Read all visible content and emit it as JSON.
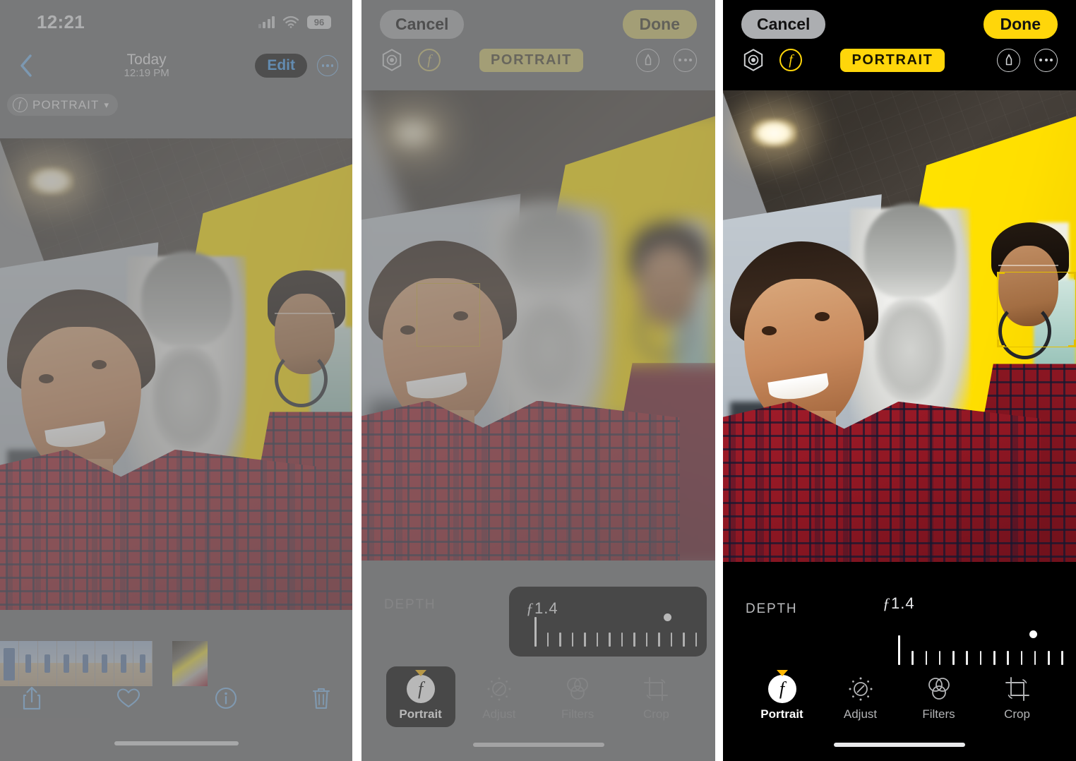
{
  "panels": [
    {
      "id": "viewer",
      "statusbar": {
        "time": "12:21",
        "battery": "96",
        "wifi_icon": "wifi-icon",
        "signal_icon": "cellular-signal-icon"
      },
      "navbar": {
        "back_icon": "chevron-left-icon",
        "title": "Today",
        "subtitle": "12:19 PM",
        "edit_label": "Edit",
        "more_icon": "ellipsis-circle-icon"
      },
      "badge": {
        "icon": "aperture-f-icon",
        "label": "PORTRAIT",
        "chevron": "chevron-down-icon"
      },
      "toolbar": [
        {
          "name": "share-button",
          "icon": "share-icon"
        },
        {
          "name": "favorite-button",
          "icon": "heart-icon"
        },
        {
          "name": "info-button",
          "icon": "info-circle-icon"
        },
        {
          "name": "delete-button",
          "icon": "trash-icon"
        }
      ],
      "filmstrip_frames": 8
    },
    {
      "id": "editor-dimmed",
      "header": {
        "cancel_label": "Cancel",
        "done_label": "Done",
        "live_icon": "live-photo-icon",
        "depth_icon": "aperture-f-icon",
        "portrait_chip": "PORTRAIT",
        "markup_icon": "markup-pen-icon",
        "more_icon": "ellipsis-circle-icon"
      },
      "depth": {
        "label": "DEPTH",
        "f_symbol": "ƒ",
        "value": "1.4",
        "ticks_total": 14
      },
      "tabs": [
        {
          "label": "Portrait",
          "icon": "portrait-f-icon",
          "active": true
        },
        {
          "label": "Adjust",
          "icon": "adjust-dial-icon",
          "active": false
        },
        {
          "label": "Filters",
          "icon": "filters-circles-icon",
          "active": false
        },
        {
          "label": "Crop",
          "icon": "crop-rotate-icon",
          "active": false
        }
      ]
    },
    {
      "id": "editor-active",
      "header": {
        "cancel_label": "Cancel",
        "done_label": "Done",
        "live_icon": "live-photo-icon",
        "depth_icon": "aperture-f-icon",
        "portrait_chip": "PORTRAIT",
        "markup_icon": "markup-pen-icon",
        "more_icon": "ellipsis-circle-icon"
      },
      "depth": {
        "label": "DEPTH",
        "f_symbol": "ƒ",
        "value": "1.4",
        "ticks_total": 14
      },
      "tabs": [
        {
          "label": "Portrait",
          "icon": "portrait-f-icon",
          "active": true
        },
        {
          "label": "Adjust",
          "icon": "adjust-dial-icon",
          "active": false
        },
        {
          "label": "Filters",
          "icon": "filters-circles-icon",
          "active": false
        },
        {
          "label": "Crop",
          "icon": "crop-rotate-icon",
          "active": false
        }
      ]
    }
  ],
  "colors": {
    "accent_yellow": "#ffd60a",
    "ios_blue": "#3f9bf0",
    "focus_box": "#e4bf00",
    "dim_backdrop": "#6f7073",
    "editor_black": "#000000"
  }
}
